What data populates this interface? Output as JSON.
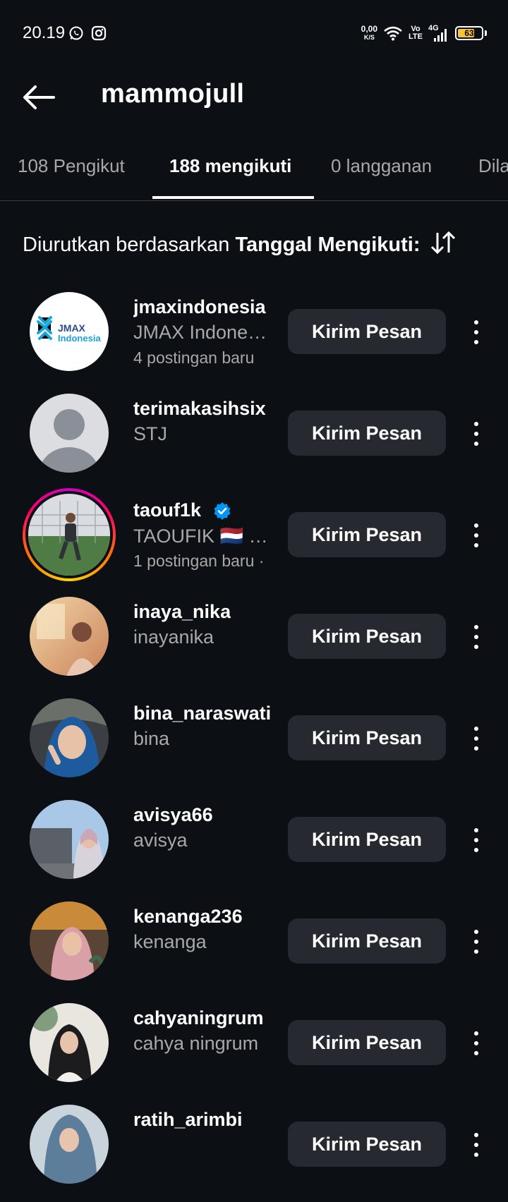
{
  "status_bar": {
    "time": "20.19",
    "net_speed_value": "0,00",
    "net_speed_unit": "K/S",
    "volte_top": "Vo",
    "volte_bottom": "LTE",
    "network": "4G",
    "battery": "63",
    "icons": [
      "whatsapp-icon",
      "instagram-icon",
      "wifi-icon",
      "signal-icon",
      "battery-icon"
    ]
  },
  "header": {
    "title": "mammojull"
  },
  "tabs": [
    {
      "label": "108 Pengikut",
      "active": false
    },
    {
      "label": "188 mengikuti",
      "active": true
    },
    {
      "label": "0 langganan",
      "active": false
    },
    {
      "label": "Dila",
      "active": false
    }
  ],
  "sort": {
    "prefix": "Diurutkan berdasarkan ",
    "value": "Tanggal Mengikuti:",
    "icon": "sort-arrows-icon"
  },
  "button_label": "Kirim Pesan",
  "accounts": [
    {
      "username": "jmaxindonesia",
      "fullname": "JMAX Indonesia",
      "new_posts": "4 postingan baru",
      "avatar_text_1": "JMAX",
      "avatar_text_2": "Indonesia"
    },
    {
      "username": "terimakasihsix",
      "fullname": "STJ",
      "new_posts": ""
    },
    {
      "username": "taouf1k",
      "fullname": "TAOUFIK 🇳🇱 …",
      "new_posts": "1 postingan baru ·",
      "verified": true
    },
    {
      "username": "inaya_nika",
      "fullname": "inayanika",
      "new_posts": ""
    },
    {
      "username": "bina_naraswati",
      "fullname": "bina",
      "new_posts": ""
    },
    {
      "username": "avisya66",
      "fullname": "avisya",
      "new_posts": ""
    },
    {
      "username": "kenanga236",
      "fullname": "kenanga",
      "new_posts": ""
    },
    {
      "username": "cahyaningrum",
      "fullname": "cahya ningrum",
      "new_posts": ""
    },
    {
      "username": "ratih_arimbi",
      "fullname": "",
      "new_posts": ""
    }
  ],
  "colors": {
    "background": "#0c1014",
    "button": "#262a30",
    "muted_text": "#a8a8a8",
    "verified": "#0095f6",
    "battery": "#f6c33b"
  }
}
